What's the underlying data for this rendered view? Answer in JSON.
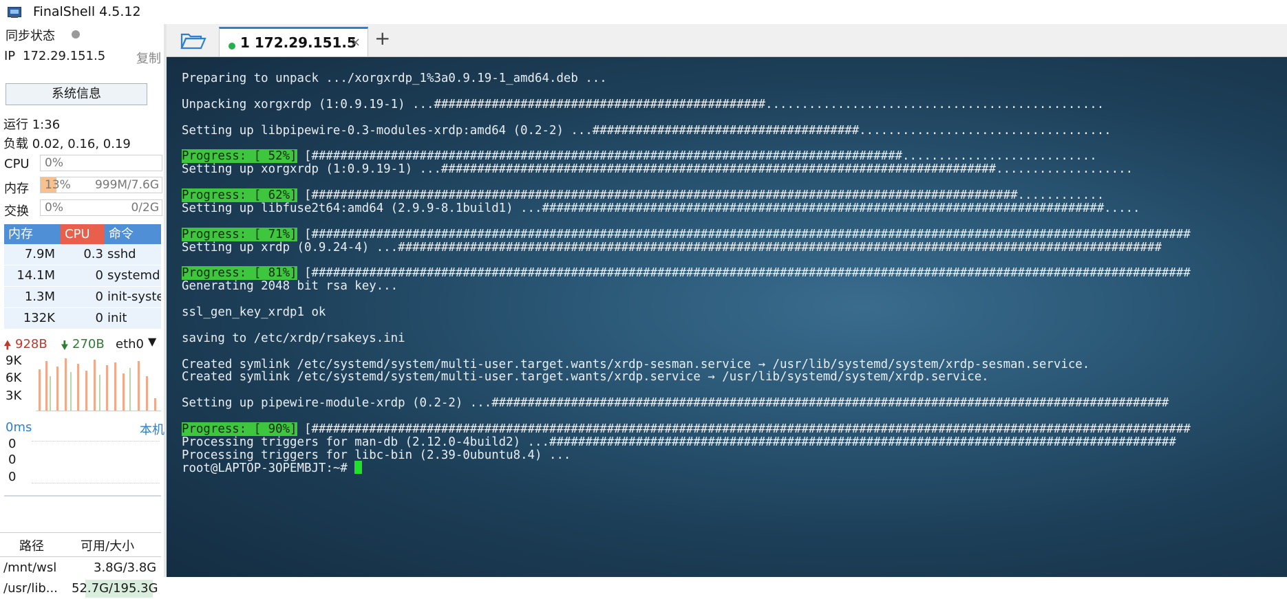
{
  "window": {
    "title": "FinalShell 4.5.12"
  },
  "sidebar": {
    "sync_label": "同步状态",
    "ip_label": "IP",
    "ip_value": "172.29.151.5",
    "copy_label": "复制",
    "sysinfo_button": "系统信息",
    "uptime": "运行 1:36",
    "load": "负载 0.02, 0.16, 0.19",
    "cpu": {
      "label": "CPU",
      "percent": "0%",
      "value": 0
    },
    "memory": {
      "label": "内存",
      "percent": "13%",
      "amount": "999M/7.6G",
      "value": 13
    },
    "swap": {
      "label": "交换",
      "percent": "0%",
      "amount": "0/2G",
      "value": 0
    },
    "process_table": {
      "headers": [
        "内存",
        "CPU",
        "命令"
      ],
      "rows": [
        {
          "mem": "7.9M",
          "cpu": "0.3",
          "cmd": "sshd"
        },
        {
          "mem": "14.1M",
          "cpu": "0",
          "cmd": "systemd"
        },
        {
          "mem": "1.3M",
          "cpu": "0",
          "cmd": "init-syste"
        },
        {
          "mem": "132K",
          "cpu": "0",
          "cmd": "init"
        }
      ]
    },
    "network": {
      "up": "928B",
      "down": "270B",
      "interface": "eth0",
      "y_ticks": [
        "9K",
        "6K",
        "3K"
      ]
    },
    "ping": {
      "latency": "0ms",
      "host": "本机",
      "values": [
        "0",
        "0",
        "0"
      ]
    },
    "disk": {
      "headers": [
        "路径",
        "可用/大小"
      ],
      "rows": [
        {
          "path": "/mnt/wsl",
          "size": "3.8G/3.8G",
          "usage": 0
        },
        {
          "path": "/usr/lib...",
          "size": "52.7G/195.3G",
          "usage": 27
        }
      ]
    }
  },
  "tabs": [
    {
      "label": "1 172.29.151.5",
      "status_color": "#22b14c",
      "close": "×"
    }
  ],
  "new_tab_label": "+",
  "terminal": {
    "background": "#1d3f58",
    "lines": [
      "Preparing to unpack .../xorgxrdp_1%3a0.9.19-1_amd64.deb ...",
      "",
      "Unpacking xorgxrdp (1:0.9.19-1) ...##############################################...............................................",
      "",
      "Setting up libpipewire-0.3-modules-xrdp:amd64 (0.2-2) ...#####################################...................................",
      "",
      "Progress: [ 52%]| [##################################################################################...........................",
      "Setting up xorgxrdp (1:0.9.19-1) ...#############################################################################...................",
      "",
      "Progress: [ 62%]| [##################################################################################################............",
      "Setting up libfuse2t64:amd64 (2.9.9-8.1build1) ...##############################################################################.....",
      "",
      "Progress: [ 71%]| [##########################################################################################################################",
      "Setting up xrdp (0.9.24-4) ...##########################################################################################################",
      "",
      "Progress: [ 81%]| [##########################################################################################################################",
      "Generating 2048 bit rsa key...",
      "",
      "ssl_gen_key_xrdp1 ok",
      "",
      "saving to /etc/xrdp/rsakeys.ini",
      "",
      "Created symlink /etc/systemd/system/multi-user.target.wants/xrdp-sesman.service → /usr/lib/systemd/system/xrdp-sesman.service.",
      "Created symlink /etc/systemd/system/multi-user.target.wants/xrdp.service → /usr/lib/systemd/system/xrdp.service.",
      "",
      "Setting up pipewire-module-xrdp (0.2-2) ...##############################################################################################",
      "",
      "Progress: [ 90%]| [##########################################################################################################################",
      "Processing triggers for man-db (2.12.0-4build2) ...#######################################################################################",
      "Processing triggers for libc-bin (2.39-0ubuntu8.4) ...",
      "root@LAPTOP-3OPEMBJT:~# "
    ],
    "progress_tags": [
      "Progress: [ 52%]",
      "Progress: [ 62%]",
      "Progress: [ 71%]",
      "Progress: [ 81%]",
      "Progress: [ 90%]"
    ]
  }
}
